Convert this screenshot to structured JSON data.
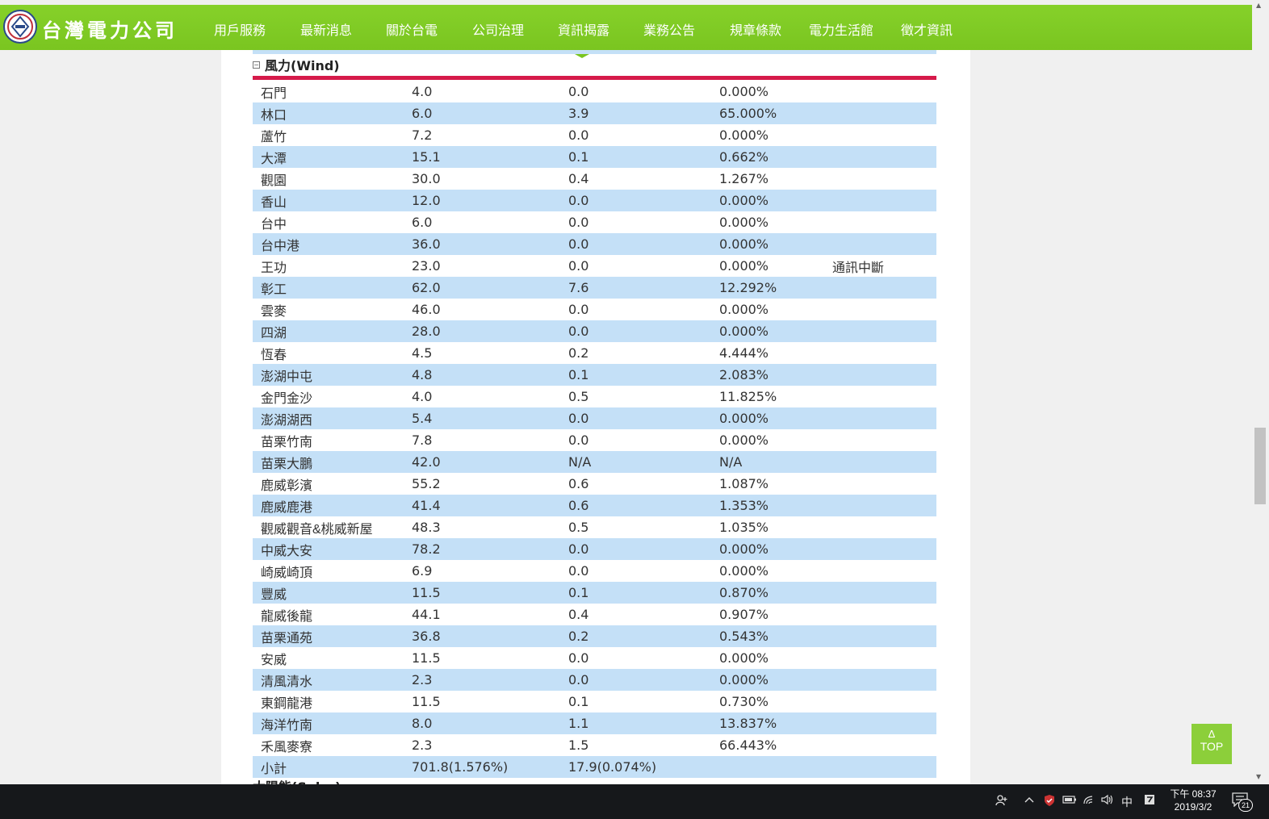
{
  "header": {
    "brand": "台灣電力公司",
    "nav": [
      "用戶服務",
      "最新消息",
      "關於台電",
      "公司治理",
      "資訊揭露",
      "業務公告",
      "規章條款",
      "電力生活館",
      "徵才資訊"
    ]
  },
  "section": {
    "toggle": "−",
    "title": "風力(Wind)",
    "next_title": "太陽能(Solar)"
  },
  "rows": [
    [
      "石門",
      "4.0",
      "0.0",
      "0.000%",
      ""
    ],
    [
      "林口",
      "6.0",
      "3.9",
      "65.000%",
      ""
    ],
    [
      "蘆竹",
      "7.2",
      "0.0",
      "0.000%",
      ""
    ],
    [
      "大潭",
      "15.1",
      "0.1",
      "0.662%",
      ""
    ],
    [
      "觀園",
      "30.0",
      "0.4",
      "1.267%",
      ""
    ],
    [
      "香山",
      "12.0",
      "0.0",
      "0.000%",
      ""
    ],
    [
      "台中",
      "6.0",
      "0.0",
      "0.000%",
      ""
    ],
    [
      "台中港",
      "36.0",
      "0.0",
      "0.000%",
      ""
    ],
    [
      "王功",
      "23.0",
      "0.0",
      "0.000%",
      "通訊中斷"
    ],
    [
      "彰工",
      "62.0",
      "7.6",
      "12.292%",
      ""
    ],
    [
      "雲麥",
      "46.0",
      "0.0",
      "0.000%",
      ""
    ],
    [
      "四湖",
      "28.0",
      "0.0",
      "0.000%",
      ""
    ],
    [
      "恆春",
      "4.5",
      "0.2",
      "4.444%",
      ""
    ],
    [
      "澎湖中屯",
      "4.8",
      "0.1",
      "2.083%",
      ""
    ],
    [
      "金門金沙",
      "4.0",
      "0.5",
      "11.825%",
      ""
    ],
    [
      "澎湖湖西",
      "5.4",
      "0.0",
      "0.000%",
      ""
    ],
    [
      "苗栗竹南",
      "7.8",
      "0.0",
      "0.000%",
      ""
    ],
    [
      "苗栗大鵬",
      "42.0",
      "N/A",
      "N/A",
      ""
    ],
    [
      "鹿威彰濱",
      "55.2",
      "0.6",
      "1.087%",
      ""
    ],
    [
      "鹿威鹿港",
      "41.4",
      "0.6",
      "1.353%",
      ""
    ],
    [
      "觀威觀音&桃威新屋",
      "48.3",
      "0.5",
      "1.035%",
      ""
    ],
    [
      "中威大安",
      "78.2",
      "0.0",
      "0.000%",
      ""
    ],
    [
      "崎威崎頂",
      "6.9",
      "0.0",
      "0.000%",
      ""
    ],
    [
      "豐威",
      "11.5",
      "0.1",
      "0.870%",
      ""
    ],
    [
      "龍威後龍",
      "44.1",
      "0.4",
      "0.907%",
      ""
    ],
    [
      "苗栗通苑",
      "36.8",
      "0.2",
      "0.543%",
      ""
    ],
    [
      "安威",
      "11.5",
      "0.0",
      "0.000%",
      ""
    ],
    [
      "清風清水",
      "2.3",
      "0.0",
      "0.000%",
      ""
    ],
    [
      "東鋼龍港",
      "11.5",
      "0.1",
      "0.730%",
      ""
    ],
    [
      "海洋竹南",
      "8.0",
      "1.1",
      "13.837%",
      ""
    ],
    [
      "禾風麥寮",
      "2.3",
      "1.5",
      "66.443%",
      ""
    ],
    [
      "小計",
      "701.8(1.576%)",
      "17.9(0.074%)",
      "",
      ""
    ]
  ],
  "top_button": {
    "arrow": "Δ",
    "label": "TOP"
  },
  "taskbar": {
    "ime": "中",
    "time": "下午 08:37",
    "date": "2019/3/2",
    "notifications": "21"
  },
  "colors": {
    "nav_green": "#7ac520",
    "row_alt": "#c4e0f7",
    "section_rule": "#d61a4a"
  }
}
